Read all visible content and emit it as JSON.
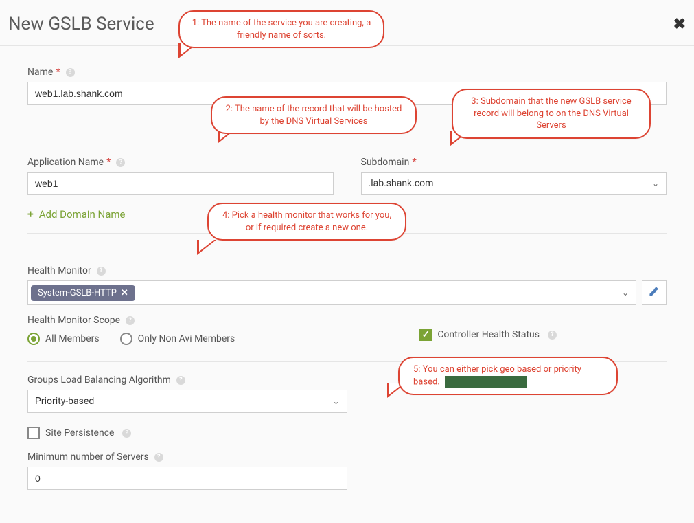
{
  "header": {
    "title": "New GSLB Service"
  },
  "fields": {
    "name": {
      "label": "Name",
      "value": "web1.lab.shank.com"
    },
    "app_name": {
      "label": "Application Name",
      "value": "web1"
    },
    "subdomain": {
      "label": "Subdomain",
      "value": ".lab.shank.com"
    },
    "add_domain": "Add Domain Name",
    "health_monitor": {
      "label": "Health Monitor",
      "chip": "System-GSLB-HTTP"
    },
    "hm_scope": {
      "label": "Health Monitor Scope",
      "opt_all": "All Members",
      "opt_nonavi": "Only Non Avi Members",
      "selected": "all"
    },
    "controller_health": {
      "label": "Controller Health Status",
      "checked": true
    },
    "group_lb": {
      "label": "Groups Load Balancing Algorithm",
      "value": "Priority-based"
    },
    "site_persist": {
      "label": "Site Persistence",
      "checked": false
    },
    "min_servers": {
      "label": "Minimum number of Servers",
      "value": "0"
    }
  },
  "annotations": {
    "a1": "1: The name of the service you are creating, a friendly name of sorts.",
    "a2": "2: The name of the record that will be hosted by the DNS Virtual Services",
    "a3": "3:  Subdomain that the new GSLB service record will belong to on the DNS Virtual Servers",
    "a4": "4:  Pick a health monitor that works for you, or if required create a new one.",
    "a5": "5: You can either pick geo based or priority based. "
  }
}
